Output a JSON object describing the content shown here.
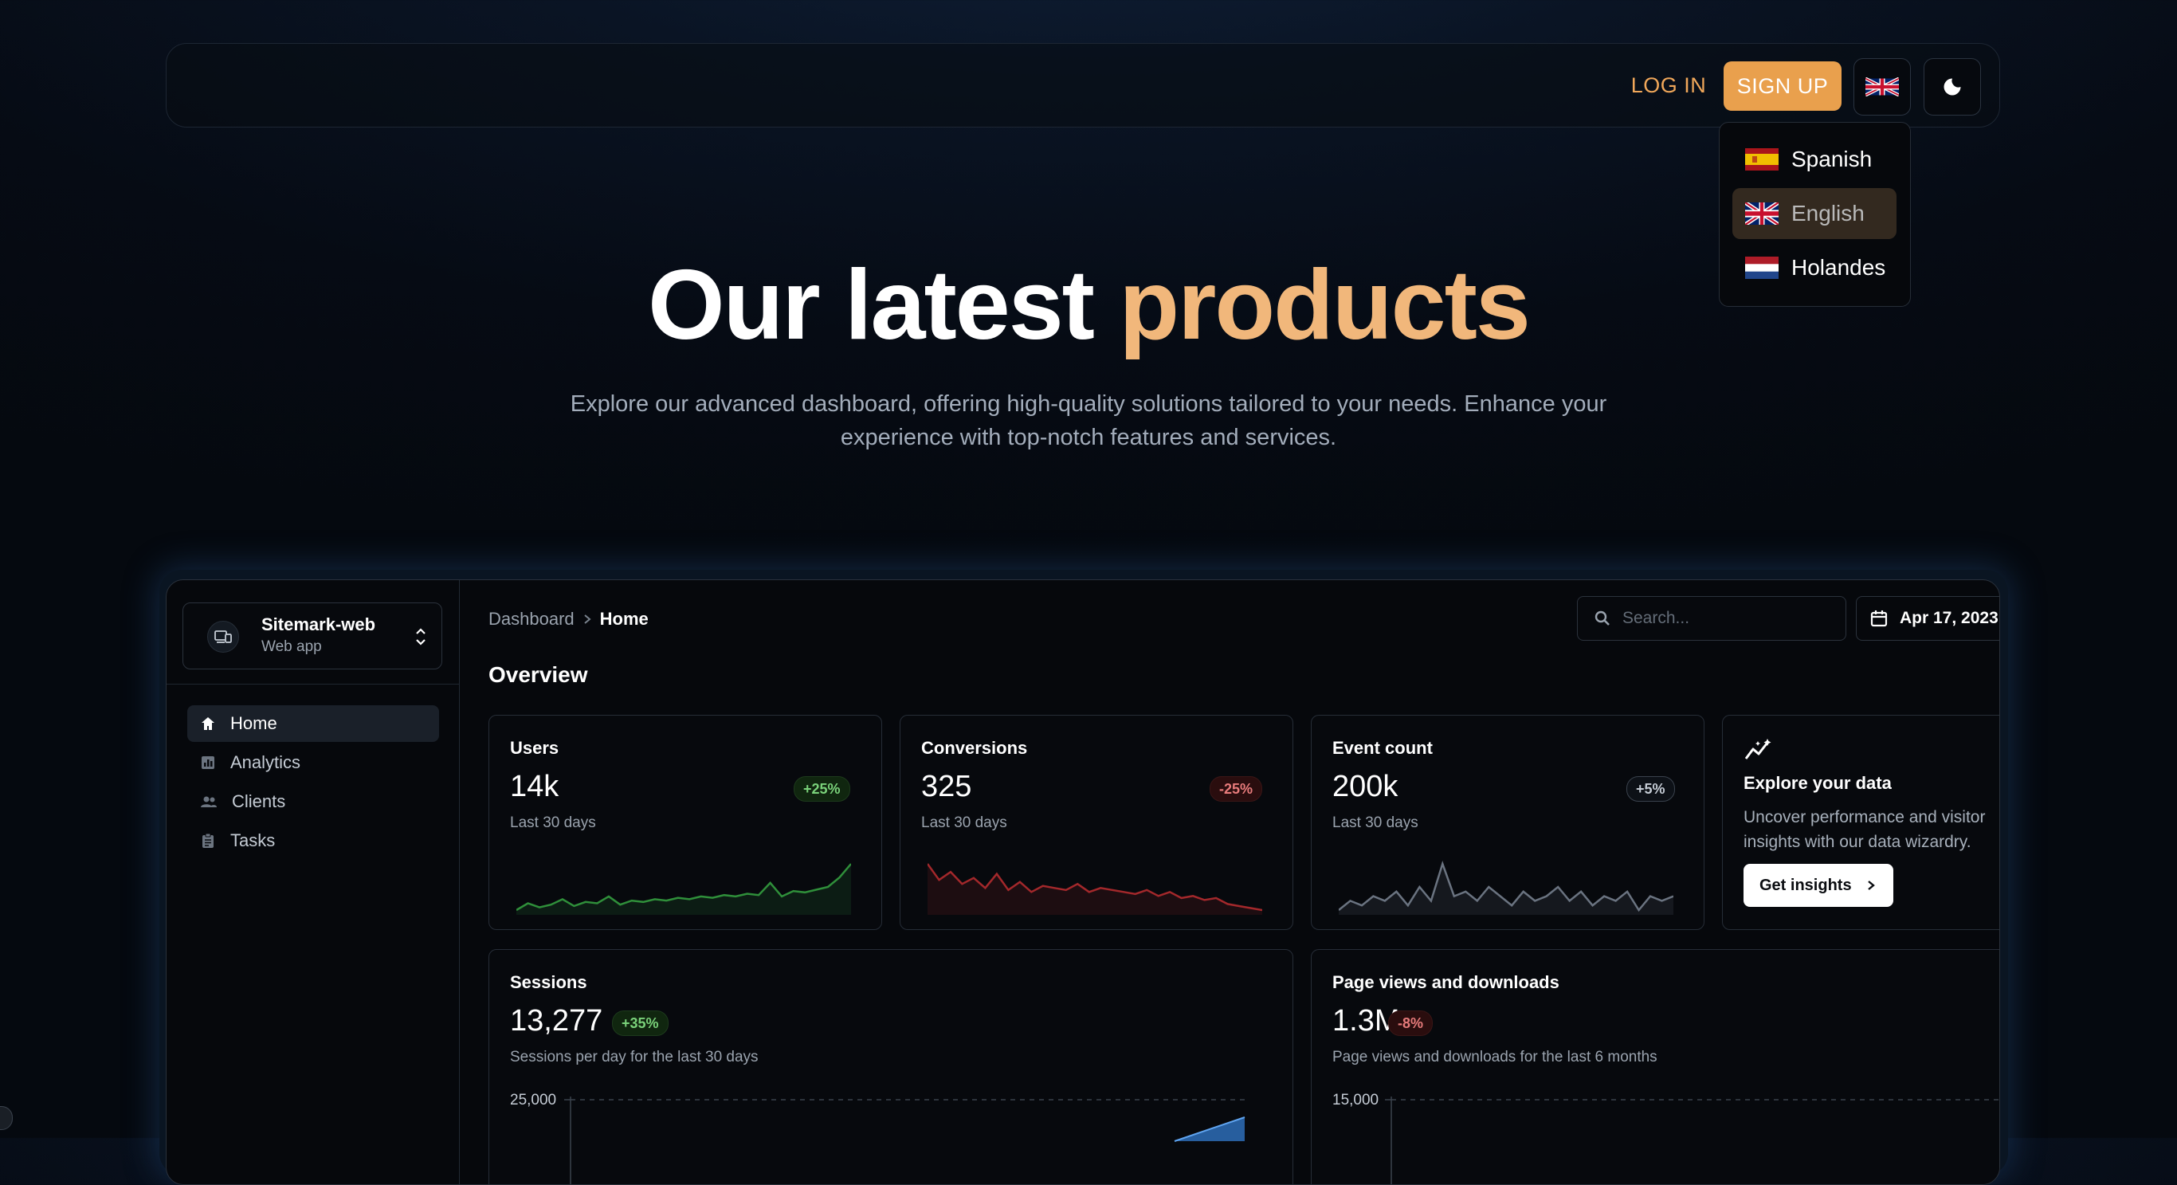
{
  "nav": {
    "login_label": "LOG IN",
    "signup_label": "SIGN UP",
    "language_icon": "uk-flag-icon",
    "theme_icon": "moon-icon"
  },
  "language_menu": {
    "items": [
      {
        "label": "Spanish",
        "flag": "spain-flag-icon"
      },
      {
        "label": "English",
        "flag": "uk-flag-icon",
        "selected": true
      },
      {
        "label": "Holandes",
        "flag": "netherlands-flag-icon"
      }
    ]
  },
  "hero": {
    "title_main": "Our latest",
    "title_accent": "products",
    "subtitle": "Explore our advanced dashboard, offering high-quality solutions tailored to your needs. Enhance your experience with top-notch features and services."
  },
  "dashboard": {
    "app": {
      "name": "Sitemark-web",
      "subtitle": "Web app"
    },
    "sidebar": [
      {
        "label": "Home",
        "icon": "home-icon",
        "active": true
      },
      {
        "label": "Analytics",
        "icon": "analytics-icon"
      },
      {
        "label": "Clients",
        "icon": "clients-icon"
      },
      {
        "label": "Tasks",
        "icon": "tasks-icon"
      }
    ],
    "breadcrumb": {
      "root": "Dashboard",
      "current": "Home"
    },
    "search_placeholder": "Search...",
    "date": "Apr 17, 2023",
    "overview_title": "Overview",
    "stats": [
      {
        "title": "Users",
        "value": "14k",
        "badge": "+25%",
        "trend": "up",
        "period": "Last 30 days",
        "spark": [
          4,
          9,
          6,
          8,
          12,
          7,
          10,
          9,
          14,
          8,
          11,
          10,
          12,
          11,
          13,
          12,
          14,
          13,
          15,
          14,
          16,
          15,
          24,
          14,
          18,
          17,
          19,
          21,
          28,
          38
        ],
        "color": "#2f8f3a"
      },
      {
        "title": "Conversions",
        "value": "325",
        "badge": "-25%",
        "trend": "down",
        "period": "Last 30 days",
        "spark": [
          34,
          26,
          30,
          24,
          27,
          22,
          29,
          21,
          25,
          20,
          23,
          22,
          21,
          24,
          20,
          22,
          21,
          20,
          19,
          21,
          18,
          20,
          17,
          18,
          16,
          17,
          14,
          13,
          12,
          11
        ],
        "color": "#a3282b"
      },
      {
        "title": "Event count",
        "value": "200k",
        "badge": "+5%",
        "trend": "neutral",
        "period": "Last 30 days",
        "spark": [
          18,
          20,
          19,
          21,
          20,
          22,
          19,
          23,
          20,
          28,
          21,
          22,
          20,
          23,
          21,
          19,
          22,
          20,
          21,
          23,
          20,
          22,
          19,
          21,
          20,
          22,
          18,
          21,
          20,
          21
        ],
        "color": "#6a7380"
      }
    ],
    "insight": {
      "icon": "insights-icon",
      "title": "Explore your data",
      "description": "Uncover performance and visitor insights with our data wizardry.",
      "button_label": "Get insights"
    },
    "sessions": {
      "title": "Sessions",
      "value": "13,277",
      "badge": "+35%",
      "subtitle": "Sessions per day for the last 30 days",
      "y_top_tick": "25,000"
    },
    "pageviews": {
      "title": "Page views and downloads",
      "value": "1.3M",
      "badge": "-8%",
      "subtitle": "Page views and downloads for the last 6 months",
      "y_top_tick": "15,000"
    }
  }
}
